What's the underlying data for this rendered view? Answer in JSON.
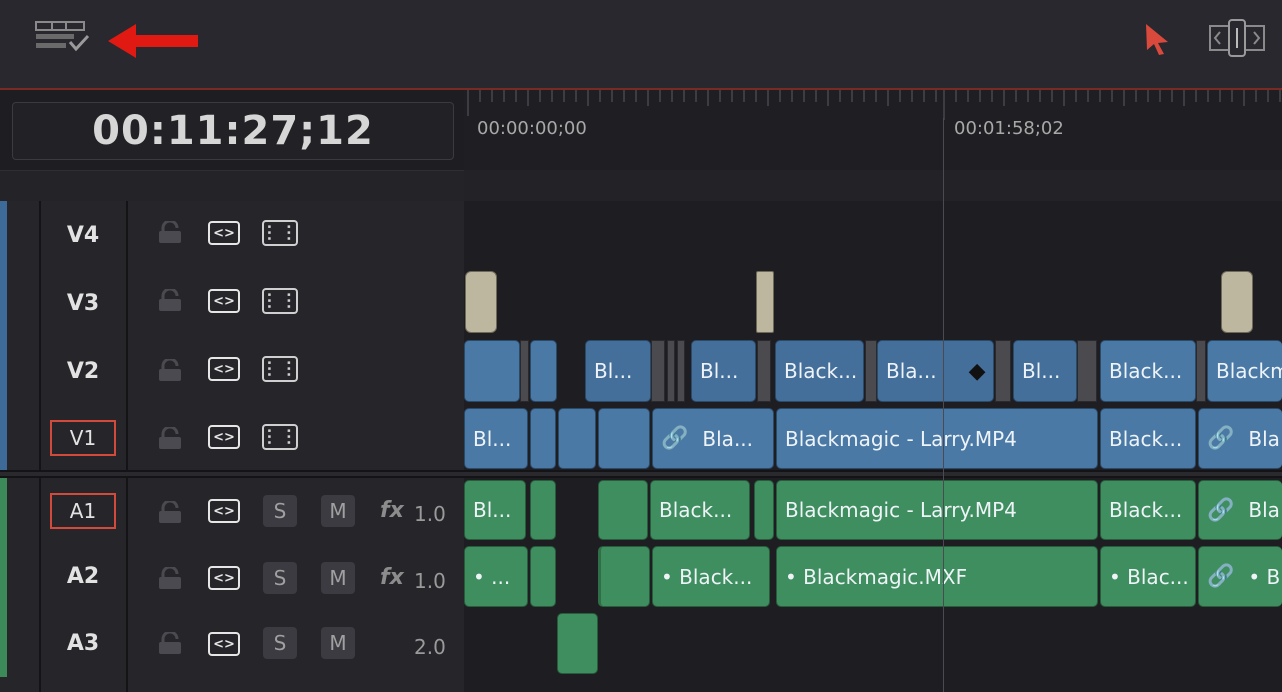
{
  "toolbar": {
    "left_icon": "timeline-options-icon",
    "arrow_icon": "red-arrow-icon",
    "cursor_icon": "selection-pointer-icon",
    "trim_icon": "trim-mode-icon"
  },
  "timecode": "00:11:27;12",
  "ruler": {
    "tc1": "00:00:00;00",
    "tc2": "00:01:58;02"
  },
  "tracks": {
    "v4": {
      "name": "V4"
    },
    "v3": {
      "name": "V3"
    },
    "v2": {
      "name": "V2"
    },
    "v1": {
      "name": "V1"
    },
    "a1": {
      "name": "A1",
      "solo": "S",
      "mute": "M",
      "fx": "fx",
      "volume": "1.0"
    },
    "a2": {
      "name": "A2",
      "solo": "S",
      "mute": "M",
      "fx": "fx",
      "volume": "1.0"
    },
    "a3": {
      "name": "A3",
      "solo": "S",
      "mute": "M",
      "volume": "2.0"
    }
  },
  "clips": {
    "v2": [
      "Bl...",
      "Bl...",
      "Black...",
      "Bla...",
      "Bl...",
      "Black...",
      "Blackm"
    ],
    "v1": [
      "Bl...",
      "Bla...",
      "Blackmagic - Larry.MP4",
      "Black...",
      "Bla"
    ],
    "a1": [
      "Bl...",
      "Black...",
      "Blackmagic - Larry.MP4",
      "Black...",
      "Bla"
    ],
    "a2": [
      "• ...",
      "• Black...",
      "• Blackmagic.MXF",
      "• Blac...",
      "• B"
    ]
  },
  "colors": {
    "video_track": "#4a79a6",
    "audio_track": "#3f8e5f",
    "accent_red": "#d24a3c"
  }
}
